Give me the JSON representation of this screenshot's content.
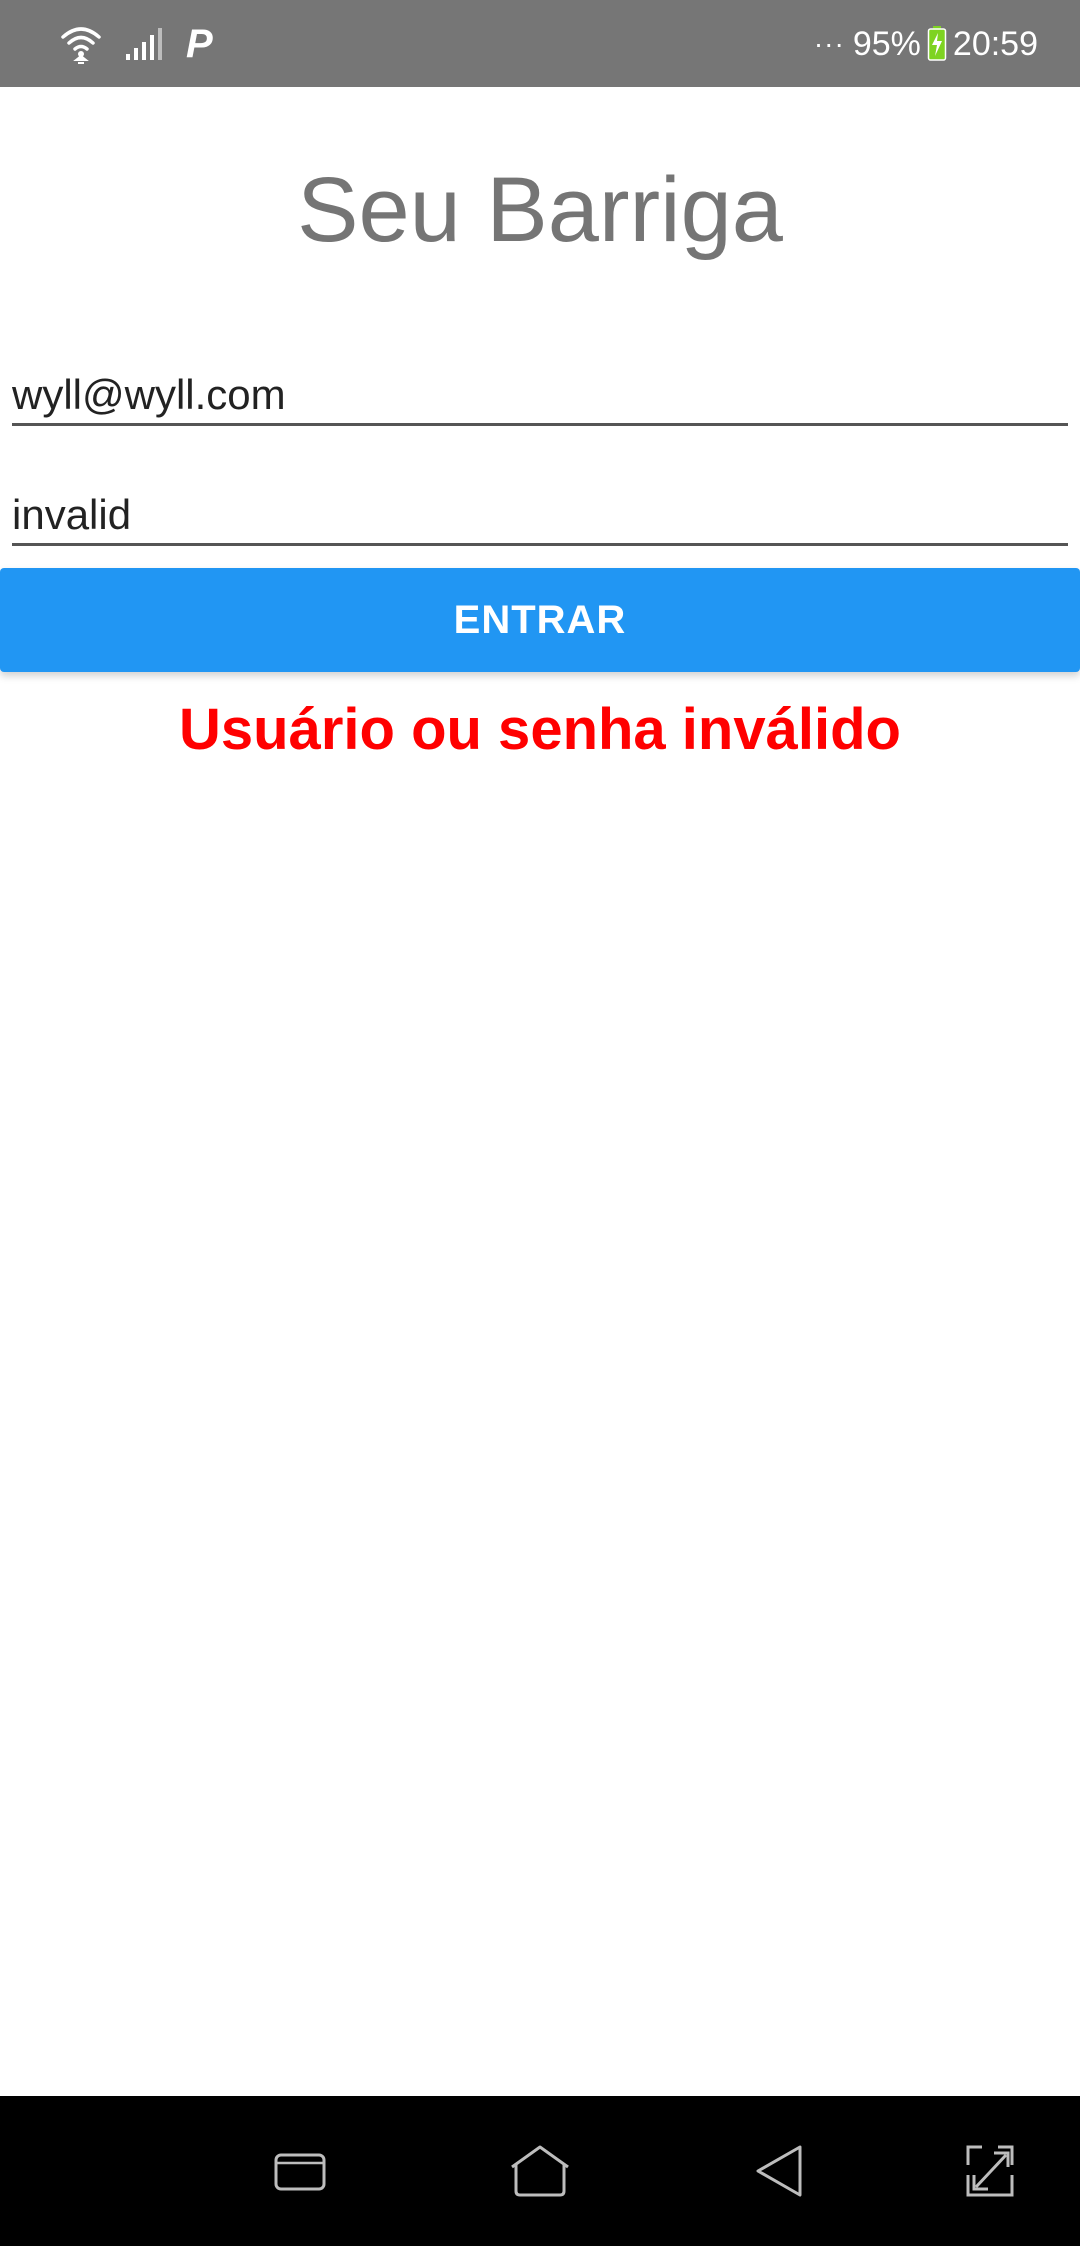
{
  "status_bar": {
    "dots": "···",
    "battery_percent": "95%",
    "time": "20:59",
    "battery_color": "#7ed321",
    "icons": [
      "wifi-icon",
      "signal-icon",
      "parking-icon"
    ]
  },
  "app": {
    "title": "Seu Barriga"
  },
  "login_form": {
    "email_value": "wyll@wyll.com",
    "password_value": "invalid",
    "submit_label": "ENTRAR",
    "error_message": "Usuário ou senha inválido"
  },
  "colors": {
    "accent": "#2196f3",
    "error": "#ff0000",
    "title": "#757575",
    "status_bar": "#767676"
  },
  "nav_bar": {
    "buttons": [
      "recent-apps-icon",
      "home-icon",
      "back-icon",
      "expand-icon"
    ]
  }
}
